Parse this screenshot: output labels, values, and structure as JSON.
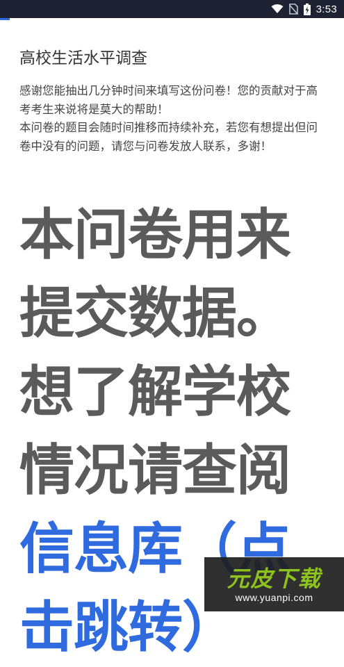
{
  "status_bar": {
    "time": "3:53",
    "icons": [
      "wifi-icon",
      "no-sim-icon",
      "battery-charging-icon"
    ],
    "background": "#1e2233",
    "accent": "#2f6bde"
  },
  "survey": {
    "title": "高校生活水平调查",
    "intro_lines": [
      "感谢您能抽出几分钟时间来填写这份问卷！您的贡献对于高考考生来说将是莫大的帮助！",
      "本问卷的题目会随时间推移而持续补充，若您有想提出但问卷中没有的问题，请您与问卷发放人联系，多谢！"
    ]
  },
  "notice": {
    "lines": [
      "本问卷用来",
      "提交数据。",
      "想了解学校",
      "情况请查阅"
    ],
    "link_lines": [
      "信息库（点",
      "击跳转）"
    ],
    "text_color": "#5b5b5b",
    "link_color": "#2f6bde"
  },
  "watermark": {
    "brand": "元皮下载",
    "url": "www.yuanpi.com",
    "brand_color": "#8dc21f"
  }
}
